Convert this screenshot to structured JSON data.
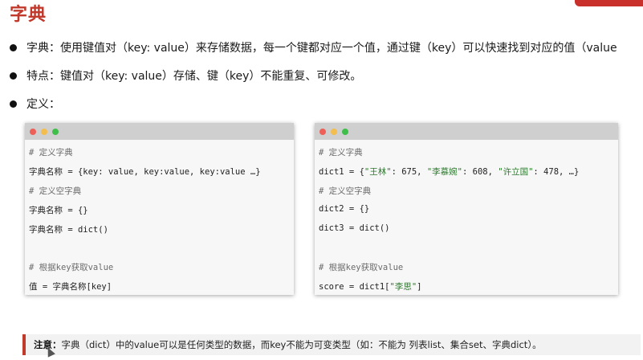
{
  "title": "字典",
  "bullets": [
    "字典：使用键值对（key: value）来存储数据，每一个键都对应一个值，通过键（key）可以快速找到对应的值（value",
    "特点：键值对（key: value）存储、键（key）不能重复、可修改。",
    "定义："
  ],
  "left_code": {
    "comment1": "# 定义字典",
    "line1": "字典名称 = {key: value, key:value, key:value …}",
    "comment2": "# 定义空字典",
    "line2": "字典名称 = {}",
    "line3": "字典名称 = dict()",
    "comment3": "# 根据key获取value",
    "line4": "值 = 字典名称[key]"
  },
  "right_code": {
    "comment1": "# 定义字典",
    "line1_prefix": "dict1 = {",
    "k1": "\"王林\"",
    "v1": ": 675, ",
    "k2": "\"李慕婉\"",
    "v2": ": 608, ",
    "k3": "\"许立国\"",
    "v3": ": 478, …}",
    "comment2": "# 定义空字典",
    "line2": "dict2 = {}",
    "line3": "dict3 = dict()",
    "comment3": "# 根据key获取value",
    "line4_prefix": "score = dict1[",
    "line4_key": "\"李思\"",
    "line4_suffix": "]"
  },
  "note": {
    "label": "注意：",
    "text": "字典（dict）中的value可以是任何类型的数据，而key不能为可变类型（如：不能为 列表list、集合set、字典dict）。"
  },
  "colors": {
    "accent": "#c0392b",
    "string": "#2a7a2a",
    "comment": "#6b6b6b"
  }
}
